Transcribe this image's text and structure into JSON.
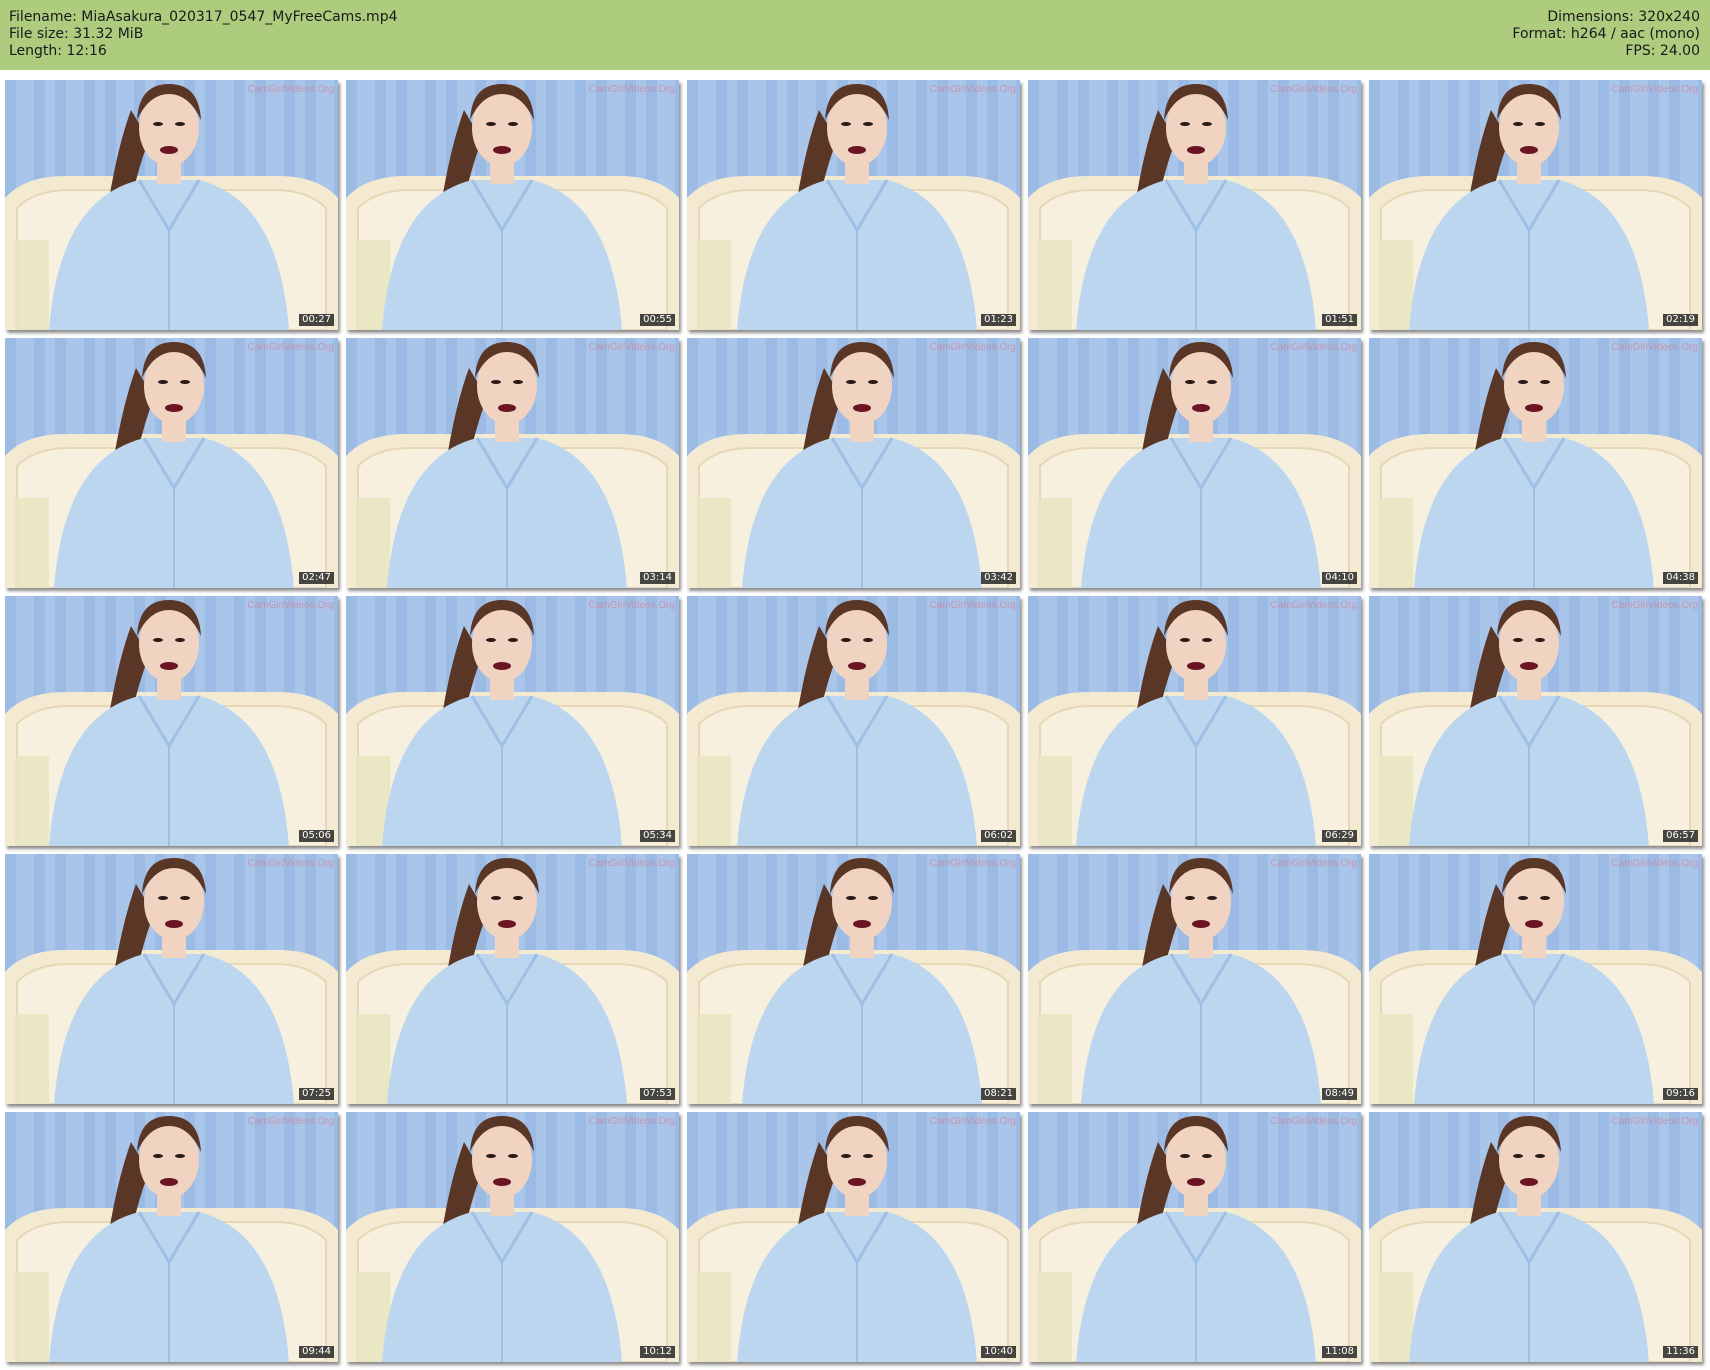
{
  "meta": {
    "left": [
      "Filename: MiaAsakura_020317_0547_MyFreeCams.mp4",
      "File size: 31.32 MiB",
      "Length: 12:16"
    ],
    "right": [
      "Dimensions: 320x240",
      "Format: h264 / aac (mono)",
      "FPS: 24.00"
    ]
  },
  "watermark": "CamGirlVideos.Org",
  "thumbnails": [
    {
      "time": "00:27"
    },
    {
      "time": "00:55"
    },
    {
      "time": "01:23"
    },
    {
      "time": "01:51"
    },
    {
      "time": "02:19"
    },
    {
      "time": "02:47"
    },
    {
      "time": "03:14"
    },
    {
      "time": "03:42"
    },
    {
      "time": "04:10"
    },
    {
      "time": "04:38"
    },
    {
      "time": "05:06"
    },
    {
      "time": "05:34"
    },
    {
      "time": "06:02"
    },
    {
      "time": "06:29"
    },
    {
      "time": "06:57"
    },
    {
      "time": "07:25"
    },
    {
      "time": "07:53"
    },
    {
      "time": "08:21"
    },
    {
      "time": "08:49"
    },
    {
      "time": "09:16"
    },
    {
      "time": "09:44"
    },
    {
      "time": "10:12"
    },
    {
      "time": "10:40"
    },
    {
      "time": "11:08"
    },
    {
      "time": "11:36"
    }
  ],
  "colors": {
    "header_bg": "#adcc7e",
    "curtain": "#a9c6ea",
    "headboard": "#f4ead2",
    "shirt": "#bcd6f0",
    "hair": "#5a3626",
    "skin": "#f1d3c1",
    "lips": "#6a1424"
  }
}
